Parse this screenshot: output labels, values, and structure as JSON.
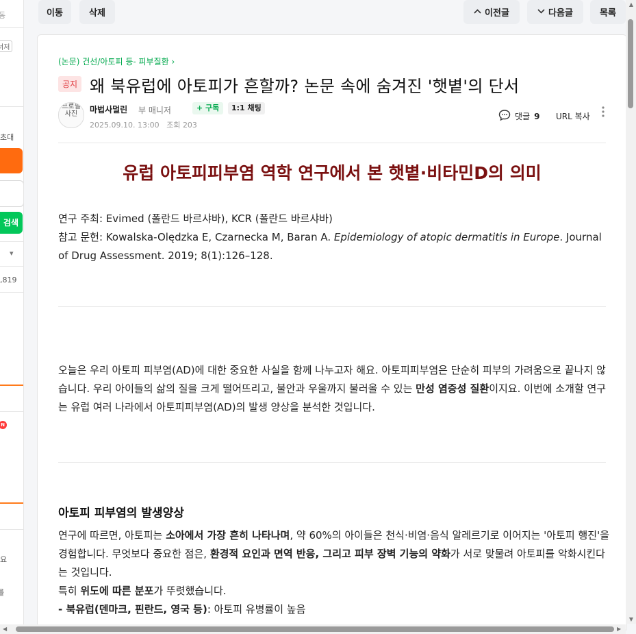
{
  "sidebar": {
    "texts": [
      "동",
      "너저",
      "초대",
      "검색",
      "▾",
      ",819",
      "N",
      "요",
      "를"
    ]
  },
  "toolbar": {
    "move": "이동",
    "delete": "삭제",
    "prev": "이전글",
    "next": "다음글",
    "list": "목록"
  },
  "article": {
    "breadcrumb": "(논문) 건선/아토피 등- 피부질환 ›",
    "notice_badge": "공지",
    "title": "왜 북유럽에 아토피가 흔할까? 논문 속에 숨겨진 '햇볕'의 단서",
    "avatar_alt": "프로필 사진",
    "author": "마법사멀린",
    "role": "부 매니저",
    "subscribe": "+ 구독",
    "chat": "1:1 채팅",
    "date": "2025.09.10. 13:00",
    "views_label": "조회",
    "views": "203",
    "comments_label": "댓글",
    "comments": "9",
    "url_copy": "URL 복사",
    "headline": "유럽 아토피피부염 역학 연구에서 본 햇볕·비타민D의 의미",
    "source_line1_label": "연구 주최:",
    "source_line1": " Evimed (폴란드 바르샤바), KCR (폴란드 바르샤바)",
    "source_line2_label": "참고 문헌:",
    "source_line2_a": " Kowalska-Olędzka E, Czarnecka M, Baran A. ",
    "source_line2_italic": "Epidemiology of atopic dermatitis in Europe",
    "source_line2_b": ". Journal of Drug Assessment. 2019; 8(1):126–128.",
    "intro_a": "오늘은 우리 아토피 피부염(AD)에 대한 중요한 사실을 함께 나누고자 해요. 아토피피부염은 단순히 피부의 가려움으로 끝나지 않습니다. 우리 아이들의 삶의 질을 크게 떨어뜨리고, 불안과 우울까지 불러올 수 있는 ",
    "intro_bold": "만성 염증성 질환",
    "intro_b": "이지요. 이번에 소개할 연구는 유럽 여러 나라에서 아토피피부염(AD)의 발생 양상을 분석한 것입니다.",
    "section_title": "아토피 피부염의 발생양상",
    "body1_a": "연구에 따르면, 아토피는 ",
    "body1_bold1": "소아에서 가장 흔히 나타나며",
    "body1_b": ", 약 60%의 아이들은 천식·비염·음식 알레르기로 이어지는 '아토피 행진'을 경험합니다. 무엇보다 중요한 점은, ",
    "body1_bold2": "환경적 요인과 면역 반응, 그리고 피부 장벽 기능의 약화",
    "body1_c": "가 서로 맞물려 아토피를 악화시킨다는 것입니다.",
    "body2_a": "특히 ",
    "body2_bold": "위도에 따른 분포",
    "body2_b": "가 뚜렷했습니다.",
    "body3_bold": "- 북유럽(덴마크, 핀란드, 영국 등)",
    "body3_b": ": 아토피 유병률이 높음"
  }
}
